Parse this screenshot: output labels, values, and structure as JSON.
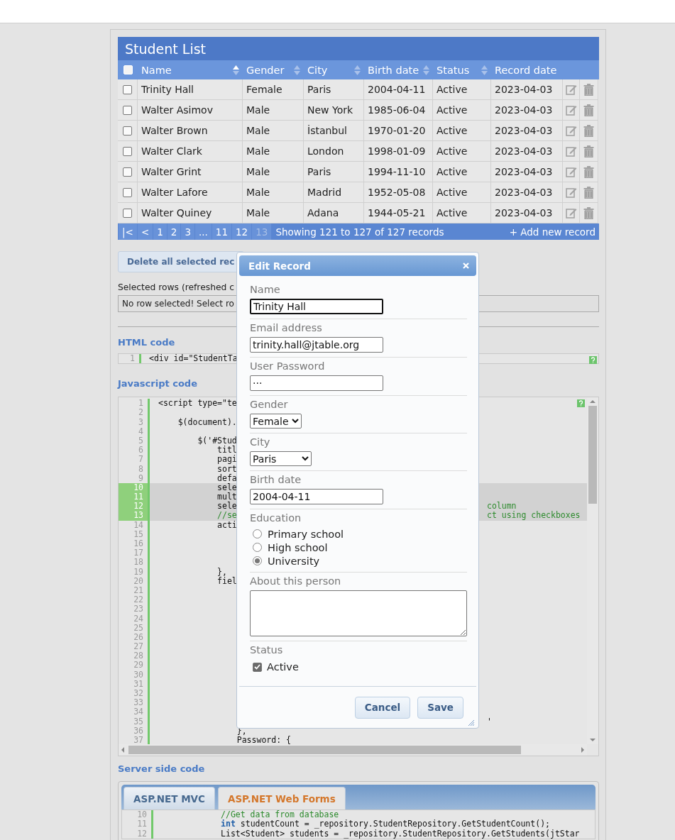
{
  "table": {
    "title": "Student List",
    "select_all": {
      "checked": false
    },
    "columns": [
      {
        "label": "Name",
        "sortable": true,
        "sorted": true
      },
      {
        "label": "Gender",
        "sortable": true,
        "sorted": false
      },
      {
        "label": "City",
        "sortable": true,
        "sorted": false
      },
      {
        "label": "Birth date",
        "sortable": true,
        "sorted": false
      },
      {
        "label": "Status",
        "sortable": true,
        "sorted": false
      },
      {
        "label": "Record date",
        "sortable": false
      }
    ],
    "rows": [
      {
        "selected": false,
        "cells": [
          "Trinity Hall",
          "Female",
          "Paris",
          "2004-04-11",
          "Active",
          "2023-04-03"
        ]
      },
      {
        "selected": false,
        "cells": [
          "Walter Asimov",
          "Male",
          "New York",
          "1985-06-04",
          "Active",
          "2023-04-03"
        ]
      },
      {
        "selected": false,
        "cells": [
          "Walter Brown",
          "Male",
          "İstanbul",
          "1970-01-20",
          "Active",
          "2023-04-03"
        ]
      },
      {
        "selected": false,
        "cells": [
          "Walter Clark",
          "Male",
          "London",
          "1998-01-09",
          "Active",
          "2023-04-03"
        ]
      },
      {
        "selected": false,
        "cells": [
          "Walter Grint",
          "Male",
          "Paris",
          "1994-11-10",
          "Active",
          "2023-04-03"
        ]
      },
      {
        "selected": false,
        "cells": [
          "Walter Lafore",
          "Male",
          "Madrid",
          "1952-05-08",
          "Active",
          "2023-04-03"
        ]
      },
      {
        "selected": false,
        "cells": [
          "Walter Quiney",
          "Male",
          "Adana",
          "1944-05-21",
          "Active",
          "2023-04-03"
        ]
      }
    ],
    "pager": {
      "buttons": [
        {
          "label": "|<",
          "selected": false
        },
        {
          "label": "<",
          "selected": false
        },
        {
          "label": "1",
          "selected": false
        },
        {
          "label": "2",
          "selected": false
        },
        {
          "label": "3",
          "selected": false
        },
        {
          "label": "...",
          "selected": false
        },
        {
          "label": "11",
          "selected": false
        },
        {
          "label": "12",
          "selected": false
        },
        {
          "label": "13",
          "selected": true
        }
      ],
      "info": "Showing 121 to 127 of 127 records",
      "add_link": "+ Add new record"
    }
  },
  "delete_button": "Delete all selected rec",
  "selected_rows": {
    "label": "Selected rows (refreshed c",
    "message": "No row selected! Select ro"
  },
  "html_code": {
    "heading": "HTML code",
    "lines": [
      {
        "num": "1",
        "text": "<div id=\"StudentTa",
        "comment": false
      }
    ]
  },
  "javascript_code": {
    "heading": "Javascript code",
    "lines": [
      {
        "num": "1",
        "text": "<script type=\"te",
        "comment": false,
        "highlighted": false
      },
      {
        "num": "2",
        "highlighted": false
      },
      {
        "num": "3",
        "text": "    $(document).",
        "comment": false,
        "highlighted": false
      },
      {
        "num": "4",
        "highlighted": false
      },
      {
        "num": "5",
        "text": "        $('#Stud",
        "comment": false,
        "highlighted": false
      },
      {
        "num": "6",
        "text": "            titl",
        "comment": false,
        "highlighted": false
      },
      {
        "num": "7",
        "text": "            pagi",
        "comment": false,
        "highlighted": false
      },
      {
        "num": "8",
        "text": "            sort",
        "comment": false,
        "highlighted": false
      },
      {
        "num": "9",
        "text": "            defa",
        "comment": false,
        "highlighted": false
      },
      {
        "num": "10",
        "text": "            sele",
        "comment": false,
        "highlighted": true
      },
      {
        "num": "11",
        "text": "            mult",
        "comment": false,
        "highlighted": true
      },
      {
        "num": "12",
        "text": "            sele",
        "comment": false,
        "highlighted": true,
        "tail": {
          "text": "column",
          "comment": true
        }
      },
      {
        "num": "13",
        "text": "            //se",
        "comment": true,
        "highlighted": true,
        "tail": {
          "text": "ct using checkboxes",
          "comment": true
        }
      },
      {
        "num": "14",
        "text": "            acti",
        "comment": false,
        "highlighted": false
      },
      {
        "num": "15",
        "highlighted": false
      },
      {
        "num": "16",
        "highlighted": false
      },
      {
        "num": "17",
        "highlighted": false
      },
      {
        "num": "18",
        "highlighted": false
      },
      {
        "num": "19",
        "text": "            },",
        "comment": false,
        "highlighted": false
      },
      {
        "num": "20",
        "text": "            fiel",
        "comment": false,
        "highlighted": false
      },
      {
        "num": "21",
        "highlighted": false
      },
      {
        "num": "22",
        "highlighted": false
      },
      {
        "num": "23",
        "highlighted": false
      },
      {
        "num": "24",
        "highlighted": false
      },
      {
        "num": "25",
        "highlighted": false
      },
      {
        "num": "26",
        "highlighted": false
      },
      {
        "num": "27",
        "highlighted": false
      },
      {
        "num": "28",
        "highlighted": false
      },
      {
        "num": "29",
        "highlighted": false
      },
      {
        "num": "30",
        "highlighted": false
      },
      {
        "num": "31",
        "highlighted": false
      },
      {
        "num": "32",
        "highlighted": false
      },
      {
        "num": "33",
        "highlighted": false
      },
      {
        "num": "34",
        "highlighted": false
      },
      {
        "num": "35",
        "highlighted": false,
        "tail": {
          "text": "'",
          "comment": false
        }
      },
      {
        "num": "36",
        "text": "                },",
        "comment": false,
        "highlighted": false
      },
      {
        "num": "37",
        "text": "                Password: {",
        "comment": false,
        "highlighted": false
      }
    ]
  },
  "server_code": {
    "heading": "Server side code",
    "tabs": [
      {
        "label": "ASP.NET MVC",
        "selected": false
      },
      {
        "label": "ASP.NET Web Forms",
        "selected": true
      }
    ],
    "lines": [
      {
        "num": "10",
        "text": "            //Get data from database",
        "comment": true
      },
      {
        "num": "11",
        "text": "            **int** studentCount = _repository.StudentRepository.GetStudentCount();",
        "comment": false
      },
      {
        "num": "12",
        "text": "            List<Student> students = _repository.StudentRepository.GetStudents(jtStar",
        "comment": false
      }
    ]
  },
  "dialog": {
    "title": "Edit Record",
    "fields": [
      {
        "kind": "text",
        "label": "Name",
        "value": "Trinity Hall",
        "focused": true
      },
      {
        "kind": "text",
        "label": "Email address",
        "value": "trinity.hall@jtable.org",
        "focused": false
      },
      {
        "kind": "text",
        "label": "User Password",
        "value": "···",
        "focused": false
      },
      {
        "kind": "select",
        "label": "Gender",
        "value": "Female"
      },
      {
        "kind": "select",
        "label": "City",
        "value": "Paris"
      },
      {
        "kind": "text",
        "label": "Birth date",
        "value": "2004-04-11",
        "focused": false
      },
      {
        "kind": "radio",
        "label": "Education",
        "options": [
          {
            "label": "Primary school",
            "selected": false
          },
          {
            "label": "High school",
            "selected": false
          },
          {
            "label": "University",
            "selected": true
          }
        ]
      },
      {
        "kind": "textarea",
        "label": "About this person"
      },
      {
        "kind": "checkbox",
        "label": "Status",
        "option": "Active",
        "checked": true
      }
    ],
    "buttons": [
      "Cancel",
      "Save"
    ]
  }
}
